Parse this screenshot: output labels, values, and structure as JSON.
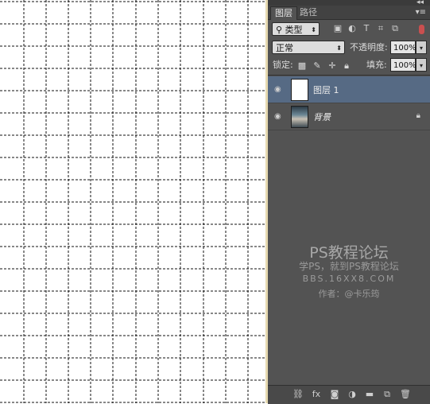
{
  "tabs": [
    {
      "label": "图层",
      "active": true
    },
    {
      "label": "路径",
      "active": false
    }
  ],
  "filter": {
    "label": "类型"
  },
  "blend_mode": {
    "value": "正常"
  },
  "opacity": {
    "label": "不透明度:",
    "value": "100%"
  },
  "lock": {
    "label": "锁定:"
  },
  "fill": {
    "label": "填充:",
    "value": "100%"
  },
  "layers": [
    {
      "name": "图层 1",
      "selected": true,
      "thumb": "white"
    },
    {
      "name": "背景",
      "selected": false,
      "thumb": "photo",
      "locked": true
    }
  ],
  "watermark": {
    "title": "PS教程论坛",
    "subtitle": "学PS，就到PS教程论坛",
    "url": "BBS.16XX8.COM",
    "author": "作者：@卡乐筠"
  },
  "colors": {
    "panel_bg": "#535353",
    "selected_layer": "#566a84",
    "canvas_bg": "#ffffff"
  }
}
